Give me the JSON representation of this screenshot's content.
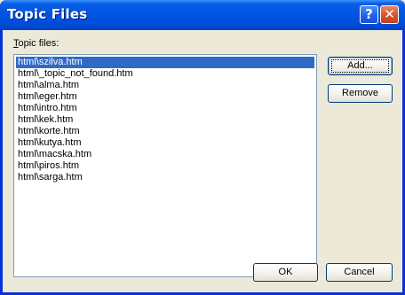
{
  "window": {
    "title": "Topic Files"
  },
  "titlebar_buttons": {
    "help": "?",
    "close": "✕"
  },
  "topic_files_label_prefix": "T",
  "topic_files_label_rest": "opic files:",
  "files": [
    "html\\szilva.htm",
    "html\\_topic_not_found.htm",
    "html\\alma.htm",
    "html\\eger.htm",
    "html\\intro.htm",
    "html\\kek.htm",
    "html\\korte.htm",
    "html\\kutya.htm",
    "html\\macska.htm",
    "html\\piros.htm",
    "html\\sarga.htm"
  ],
  "selected_index": 0,
  "buttons": {
    "add": "Add...",
    "remove": "Remove",
    "ok": "OK",
    "cancel": "Cancel"
  }
}
